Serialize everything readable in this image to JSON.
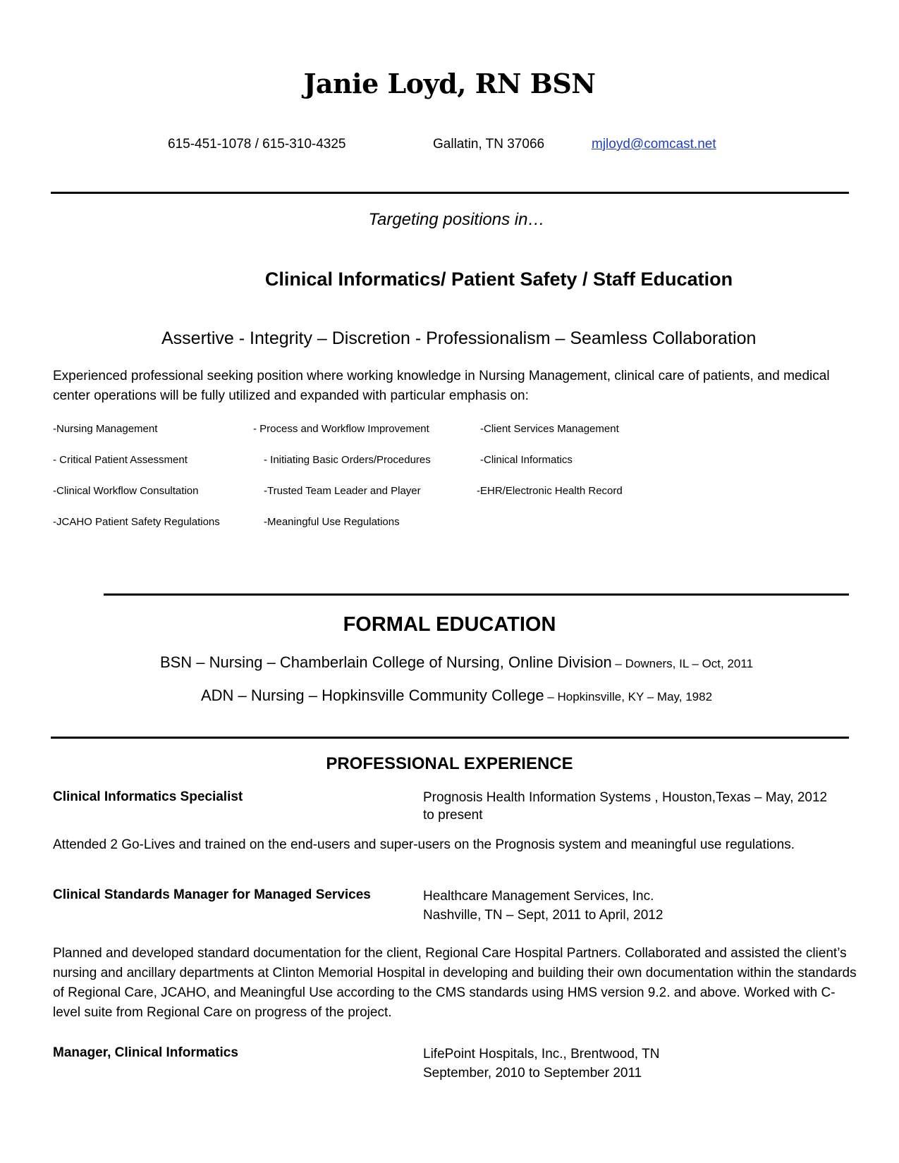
{
  "header": {
    "name": "Janie Loyd, RN BSN",
    "phones": "615-451-1078 / 615-310-4325",
    "location": "Gallatin, TN 37066",
    "email": "mjloyd@comcast.net"
  },
  "objective": {
    "targeting": "Targeting positions in…",
    "focus_areas": "Clinical Informatics/ Patient Safety / Staff Education",
    "values": "Assertive - Integrity – Discretion - Professionalism – Seamless Collaboration",
    "summary": "Experienced professional seeking position where working knowledge in Nursing Management, clinical care of patients, and medical center operations will be fully utilized and expanded with particular emphasis on:"
  },
  "skills": [
    [
      "-Nursing Management",
      "- Process and Workflow Improvement",
      "-Client Services Management"
    ],
    [
      "- Critical Patient Assessment",
      "- Initiating Basic Orders/Procedures",
      "-Clinical Informatics"
    ],
    [
      "-Clinical Workflow Consultation",
      "-Trusted Team Leader and Player",
      "-EHR/Electronic Health Record"
    ],
    [
      "-JCAHO Patient Safety Regulations",
      "-Meaningful Use Regulations",
      ""
    ]
  ],
  "education": {
    "title": "FORMAL EDUCATION",
    "entries": [
      {
        "main": "BSN – Nursing – Chamberlain College of Nursing, Online Division",
        "detail": " – Downers, IL – Oct, 2011"
      },
      {
        "main": "ADN – Nursing – Hopkinsville Community College",
        "detail": " – Hopkinsville, KY – May, 1982"
      }
    ]
  },
  "experience": {
    "title": "PROFESSIONAL EXPERIENCE",
    "jobs": [
      {
        "title": "Clinical Informatics Specialist",
        "employer": "Prognosis Health Information Systems , Houston,Texas – May, 2012 to present",
        "description": "Attended 2 Go-Lives and trained on the end-users and super-users on the Prognosis system and meaningful use regulations."
      },
      {
        "title": "Clinical Standards Manager for Managed Services",
        "employer": "Healthcare Management Services, Inc.",
        "dates": "Nashville, TN – Sept, 2011 to April, 2012",
        "description": "Planned and developed standard documentation for the client, Regional Care Hospital Partners. Collaborated and assisted the client’s nursing and ancillary departments at Clinton Memorial Hospital in developing and building their own documentation within the standards of Regional Care, JCAHO, and Meaningful Use according to the CMS standards using HMS version 9.2. and above. Worked with C-level suite from Regional Care on progress of the project."
      },
      {
        "title": "Manager, Clinical Informatics",
        "employer": "LifePoint Hospitals, Inc., Brentwood, TN",
        "dates": "September, 2010 to September 2011"
      }
    ]
  }
}
